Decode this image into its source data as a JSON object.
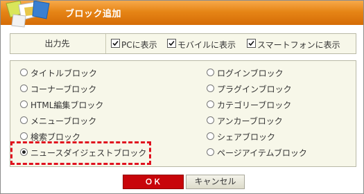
{
  "dialog": {
    "title": "ブロック追加"
  },
  "destination": {
    "label": "出力先",
    "options": [
      {
        "label": "PCに表示",
        "checked": true
      },
      {
        "label": "モバイルに表示",
        "checked": true
      },
      {
        "label": "スマートフォンに表示",
        "checked": true
      }
    ]
  },
  "blocks": {
    "left": [
      {
        "label": "タイトルブロック",
        "selected": false
      },
      {
        "label": "コーナーブロック",
        "selected": false
      },
      {
        "label": "HTML編集ブロック",
        "selected": false
      },
      {
        "label": "メニューブロック",
        "selected": false
      },
      {
        "label": "検索ブロック",
        "selected": false
      },
      {
        "label": "ニュースダイジェストブロック",
        "selected": true
      }
    ],
    "right": [
      {
        "label": "ログインブロック",
        "selected": false
      },
      {
        "label": "プラグインブロック",
        "selected": false
      },
      {
        "label": "カテゴリーブロック",
        "selected": false
      },
      {
        "label": "アンカーブロック",
        "selected": false
      },
      {
        "label": "シェアブロック",
        "selected": false
      },
      {
        "label": "ページアイテムブロック",
        "selected": false
      }
    ]
  },
  "buttons": {
    "ok": "ＯＫ",
    "cancel": "キャンセル"
  },
  "colors": {
    "title_bar": "#e68516",
    "panel_bg": "#f7f7e9",
    "ok_button": "#c8050a",
    "highlight_border": "#e0101e"
  }
}
